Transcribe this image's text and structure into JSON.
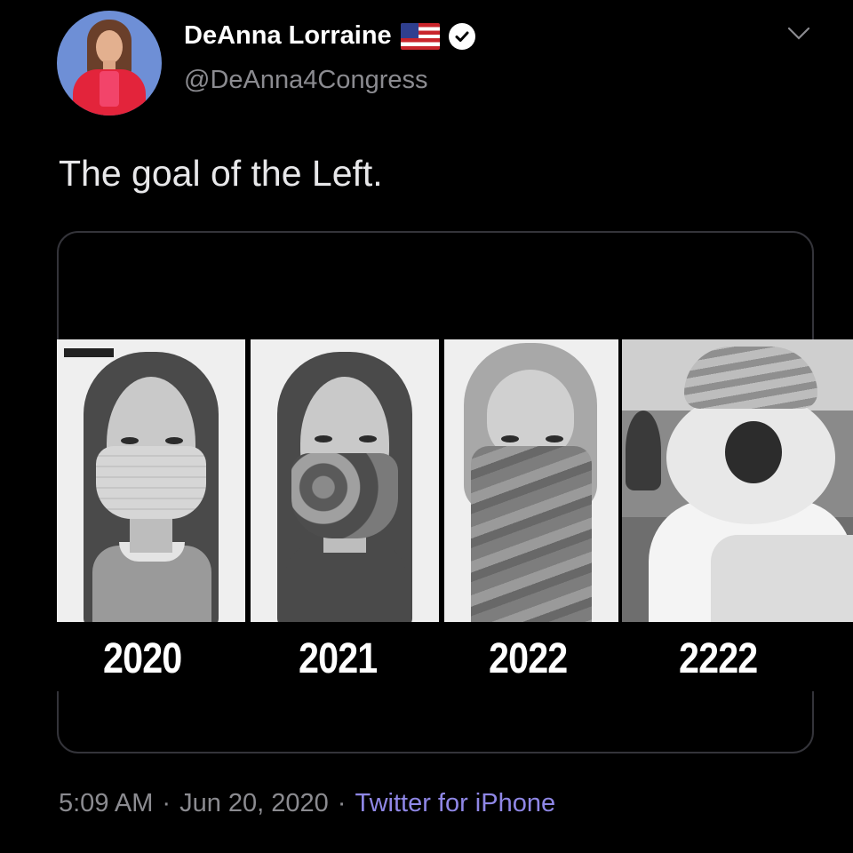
{
  "tweet": {
    "display_name": "DeAnna Lorraine",
    "handle": "@DeAnna4Congress",
    "text": "The goal of the Left.",
    "time": "5:09 AM",
    "date": "Jun 20, 2020",
    "separator": "·",
    "source": "Twitter for iPhone"
  },
  "media": {
    "years": [
      "2020",
      "2021",
      "2022",
      "2222"
    ]
  },
  "icons": {
    "flag": "us-flag-icon",
    "verified": "verified-badge-icon",
    "menu": "chevron-down-icon"
  },
  "colors": {
    "background": "#000000",
    "secondary_text": "#8b8b90",
    "source_link": "#8f87e6"
  }
}
